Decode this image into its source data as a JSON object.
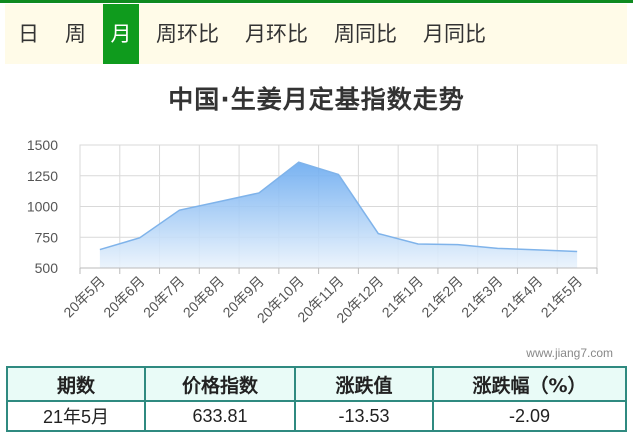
{
  "tabs": [
    {
      "label": "日",
      "active": false
    },
    {
      "label": "周",
      "active": false
    },
    {
      "label": "月",
      "active": true
    },
    {
      "label": "周环比",
      "active": false
    },
    {
      "label": "月环比",
      "active": false
    },
    {
      "label": "周同比",
      "active": false
    },
    {
      "label": "月同比",
      "active": false
    }
  ],
  "colors": {
    "accent": "#0f9b1d",
    "area_top": "#6aaaf0",
    "area_bottom": "#eaf3fc",
    "line": "#7fb3ea",
    "table_border": "#2f8a80"
  },
  "chart_data": {
    "type": "area",
    "title": "中国·生姜月定基指数走势",
    "categories": [
      "20年5月",
      "20年6月",
      "20年7月",
      "20年8月",
      "20年9月",
      "20年10月",
      "20年11月",
      "20年12月",
      "21年1月",
      "21年2月",
      "21年3月",
      "21年4月",
      "21年5月"
    ],
    "values": [
      650,
      745,
      970,
      1040,
      1110,
      1360,
      1260,
      780,
      695,
      690,
      660,
      647,
      634
    ],
    "yticks": [
      500,
      750,
      1000,
      1250,
      1500
    ],
    "ylim": [
      500,
      1500
    ],
    "grid": true
  },
  "watermark": "www.jiang7.com",
  "table": {
    "headers": [
      "期数",
      "价格指数",
      "涨跌值",
      "涨跌幅（%）"
    ],
    "row": [
      "21年5月",
      "633.81",
      "-13.53",
      "-2.09"
    ]
  }
}
